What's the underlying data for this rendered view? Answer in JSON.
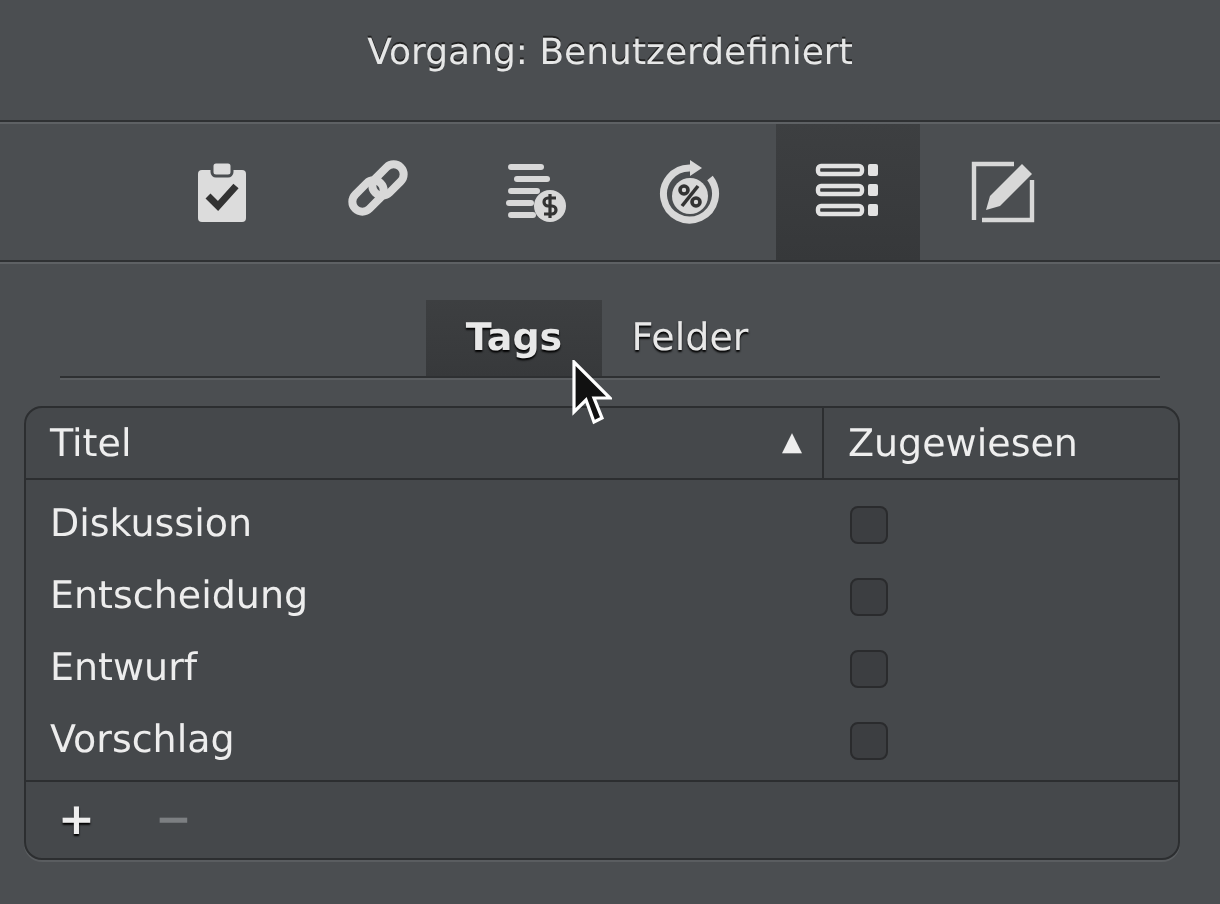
{
  "window": {
    "title": "Vorgang: Benutzerdefiniert"
  },
  "toolbar": [
    {
      "kind": "clipboard",
      "selected": false
    },
    {
      "kind": "link",
      "selected": false
    },
    {
      "kind": "costs",
      "selected": false
    },
    {
      "kind": "percent",
      "selected": false
    },
    {
      "kind": "list",
      "selected": true
    },
    {
      "kind": "edit",
      "selected": false
    }
  ],
  "tabs": [
    {
      "label": "Tags",
      "selected": true
    },
    {
      "label": "Felder",
      "selected": false
    }
  ],
  "table": {
    "columns": [
      {
        "label": "Titel",
        "sort": "▲"
      },
      {
        "label": "Zugewiesen"
      }
    ],
    "rows": [
      {
        "title": "Diskussion",
        "checked": false
      },
      {
        "title": "Entscheidung",
        "checked": false
      },
      {
        "title": "Entwurf",
        "checked": false
      },
      {
        "title": "Vorschlag",
        "checked": false
      }
    ],
    "footer_buttons": [
      {
        "label": "+",
        "disabled": false
      },
      {
        "label": "−",
        "disabled": true
      }
    ]
  }
}
